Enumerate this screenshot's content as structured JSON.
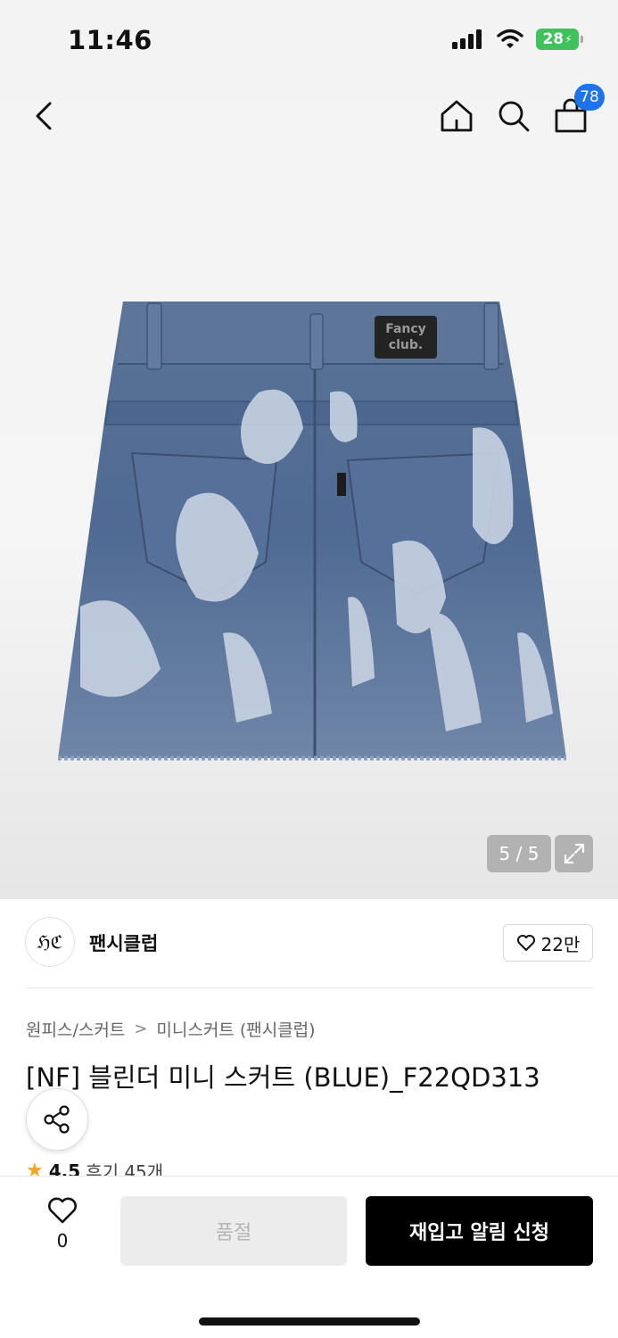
{
  "status_bar": {
    "time": "11:46",
    "battery": "28"
  },
  "nav": {
    "cart_count": "78"
  },
  "gallery": {
    "counter": "5 / 5",
    "patch_line1": "Fancy",
    "patch_line2": "club."
  },
  "brand": {
    "logo_text": "ℌℭ",
    "name": "팬시클럽",
    "likes": "22만"
  },
  "breadcrumb": {
    "category": "원피스/스커트",
    "separator": ">",
    "subcategory": "미니스커트 (팬시클럽)"
  },
  "product": {
    "title": "[NF] 블린더 미니 스커트 (BLUE)_F22QD313",
    "rating": "4.5",
    "reviews": "후기 45개"
  },
  "bottom_bar": {
    "wish_count": "0",
    "soldout_label": "품절",
    "restock_label": "재입고 알림 신청"
  },
  "colors": {
    "accent_blue": "#1e73e8",
    "battery_green": "#3fc15b",
    "star": "#f5a623",
    "denim": "#4f6a93"
  }
}
